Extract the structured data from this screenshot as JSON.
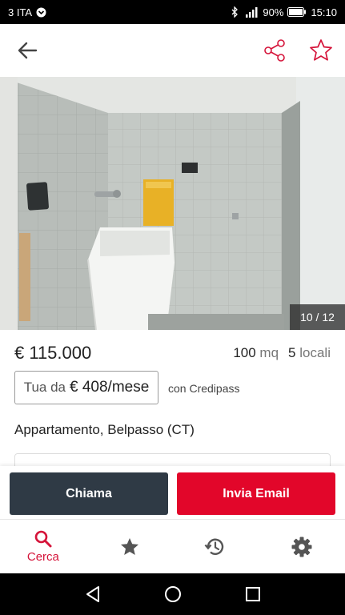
{
  "status_bar": {
    "carrier": "3 ITA",
    "battery": "90%",
    "time": "15:10"
  },
  "app_bar": {
    "back_icon": "arrow-left-icon",
    "share_icon": "share-icon",
    "favorite_icon": "star-outline-icon"
  },
  "gallery": {
    "counter": "10 / 12"
  },
  "listing": {
    "price": "€ 115.000",
    "area_value": "100",
    "area_unit": "mq",
    "rooms_value": "5",
    "rooms_unit": "locali",
    "credit_prefix": "Tua da",
    "credit_amount": "€ 408/mese",
    "credit_provider": "con Credipass",
    "title": "Appartamento, Belpasso (CT)"
  },
  "actions": {
    "call_label": "Chiama",
    "email_label": "Invia Email"
  },
  "bottom_nav": {
    "items": [
      {
        "label": "Cerca",
        "icon": "search-icon",
        "active": true
      },
      {
        "label": "",
        "icon": "star-icon",
        "active": false
      },
      {
        "label": "",
        "icon": "history-icon",
        "active": false
      },
      {
        "label": "",
        "icon": "gear-icon",
        "active": false
      }
    ]
  },
  "colors": {
    "accent": "#e2062a",
    "call_button": "#2f3a45",
    "active_nav": "#d5143a"
  }
}
